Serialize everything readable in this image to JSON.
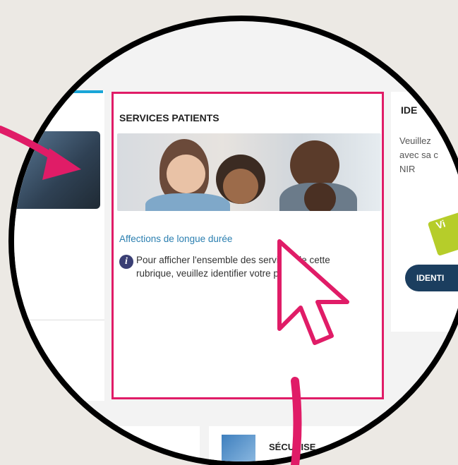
{
  "center_card": {
    "title": "SERVICES PATIENTS",
    "link": "Affections de longue durée",
    "info_text": "Pour afficher l'ensemble des services de cette rubrique, veuillez identifier votre patient."
  },
  "right_card": {
    "title": "IDE",
    "text": "Veuillez\navec sa c\nNIR",
    "badge": "Vi",
    "button": "IDENTI"
  },
  "bottom_card": {
    "label": "SÉCURISE"
  },
  "colors": {
    "highlight": "#e01c67",
    "link": "#2b7fb0",
    "button_bg": "#1b3e5f",
    "tab_accent": "#1aa6d8",
    "info_icon": "#3a3f74",
    "badge": "#b6cd2a"
  }
}
